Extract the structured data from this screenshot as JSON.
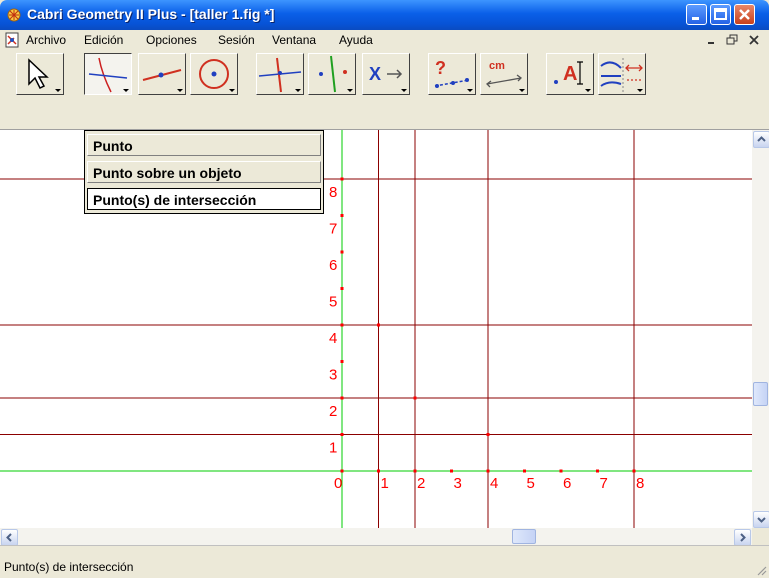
{
  "window": {
    "title": "Cabri Geometry II Plus - [taller 1.fig *]"
  },
  "menubar": {
    "items": [
      "Archivo",
      "Edición",
      "Opciones",
      "Sesión",
      "Ventana",
      "Ayuda"
    ]
  },
  "toolbar": {
    "tools": [
      {
        "name": "pointer-tool",
        "icon": "arrow-pointer-icon"
      },
      {
        "name": "point-tool",
        "icon": "point-intersection-icon",
        "pressed": true
      },
      {
        "name": "line-tool",
        "icon": "line-icon"
      },
      {
        "name": "circle-tool",
        "icon": "circle-icon"
      },
      {
        "name": "construct-tool",
        "icon": "perpendicular-icon"
      },
      {
        "name": "transform-tool",
        "icon": "symmetry-icon"
      },
      {
        "name": "macro-tool",
        "icon": "macro-icon"
      },
      {
        "name": "check-property-tool",
        "icon": "question-icon"
      },
      {
        "name": "measure-tool",
        "icon": "ruler-cm-icon"
      },
      {
        "name": "display-tool",
        "icon": "text-label-icon"
      },
      {
        "name": "draw-tool",
        "icon": "draw-style-icon"
      }
    ],
    "measure_label": "cm"
  },
  "point_menu": {
    "items": [
      "Punto",
      "Punto sobre un objeto",
      "Punto(s) de intersección"
    ],
    "selected_index": 2
  },
  "canvas": {
    "x_axis_labels": [
      "0",
      "1",
      "2",
      "3",
      "4",
      "5",
      "6",
      "7",
      "8"
    ],
    "y_axis_labels": [
      "1",
      "2",
      "3",
      "4",
      "5",
      "6",
      "7",
      "8"
    ],
    "axis_color": "#00cc00",
    "line_color": "#8b0000",
    "label_color": "#ff0000"
  },
  "status": {
    "text": "Punto(s) de intersección"
  }
}
